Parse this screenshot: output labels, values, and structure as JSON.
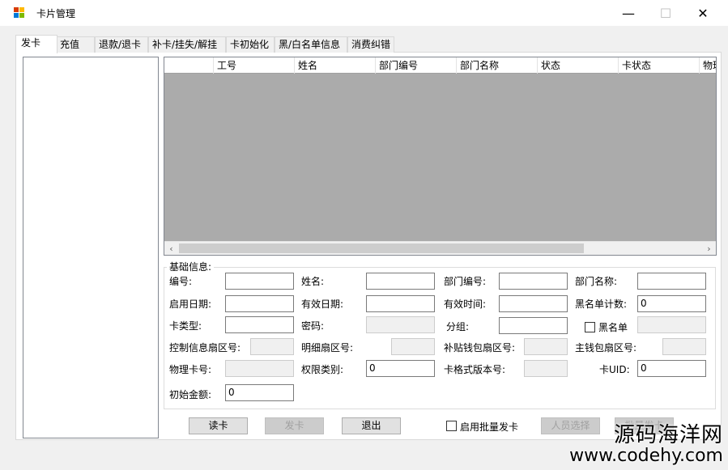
{
  "window": {
    "title": "卡片管理",
    "minimize_glyph": "—",
    "maximize_glyph": "☐",
    "close_glyph": "✕"
  },
  "tabs": [
    {
      "label": "发卡",
      "active": true
    },
    {
      "label": "充值"
    },
    {
      "label": "退款/退卡"
    },
    {
      "label": "补卡/挂失/解挂"
    },
    {
      "label": "卡初始化"
    },
    {
      "label": "黑/白名单信息"
    },
    {
      "label": "消费纠错"
    }
  ],
  "grid": {
    "columns": [
      "",
      "工号",
      "姓名",
      "部门编号",
      "部门名称",
      "状态",
      "卡状态",
      "物理"
    ],
    "scroll_left": "‹",
    "scroll_right": "›"
  },
  "basic_info": {
    "title": "基础信息:",
    "fields": {
      "number": {
        "label": "编号:",
        "value": ""
      },
      "name": {
        "label": "姓名:",
        "value": ""
      },
      "dept_no": {
        "label": "部门编号:",
        "value": ""
      },
      "dept_name": {
        "label": "部门名称:",
        "value": ""
      },
      "start_date": {
        "label": "启用日期:",
        "value": ""
      },
      "valid_date": {
        "label": "有效日期:",
        "value": ""
      },
      "valid_time": {
        "label": "有效时间:",
        "value": ""
      },
      "blacklist_count": {
        "label": "黑名单计数:",
        "value": "0"
      },
      "card_type": {
        "label": "卡类型:",
        "value": ""
      },
      "password": {
        "label": "密码:",
        "value": ""
      },
      "group": {
        "label": "分组:",
        "value": ""
      },
      "blacklist": {
        "label": "黑名单",
        "value": ""
      },
      "ctrl_sector": {
        "label": "控制信息扇区号:",
        "value": ""
      },
      "detail_sector": {
        "label": "明细扇区号:",
        "value": ""
      },
      "subsidy_sector": {
        "label": "补贴钱包扇区号:",
        "value": ""
      },
      "main_sector": {
        "label": "主钱包扇区号:",
        "value": ""
      },
      "physical_no": {
        "label": "物理卡号:",
        "value": ""
      },
      "perm_type": {
        "label": "权限类别:",
        "value": "0"
      },
      "card_format": {
        "label": "卡格式版本号:",
        "value": ""
      },
      "card_uid": {
        "label": "卡UID:",
        "value": "0"
      },
      "init_amount": {
        "label": "初始金额:",
        "value": "0"
      }
    }
  },
  "buttons": {
    "read": "读卡",
    "issue": "发卡",
    "exit": "退出",
    "batch_enable": "启用批量发卡",
    "select_person": "人员选择",
    "batch_issue": "批量发卡"
  },
  "watermark": {
    "line1": "源码海洋网",
    "line2": "www.codehy.com"
  }
}
